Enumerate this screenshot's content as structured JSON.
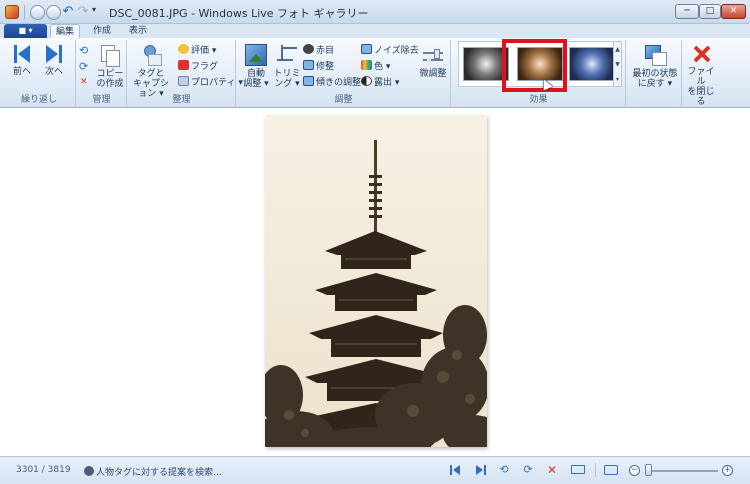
{
  "window": {
    "title": "DSC_0081.JPG - Windows Live フォト ギャラリー",
    "controls": {
      "minimize": "─",
      "maximize": "□",
      "close": "✕"
    }
  },
  "quick_access": {
    "back_icon": "back-icon",
    "forward_icon": "forward-icon",
    "undo": "↶",
    "redo": "↷",
    "dropdown": "▾"
  },
  "tabs": {
    "file_menu": "■ ▾",
    "items": [
      "編集",
      "作成",
      "表示"
    ],
    "active": "編集"
  },
  "ribbon": {
    "navigate": {
      "label": "繰り返し",
      "prev": "前へ",
      "next": "次へ"
    },
    "manage": {
      "label": "管理",
      "rotate_left": "⟲",
      "rotate_right": "⟳",
      "delete": "✕",
      "copy": "コピーの作成"
    },
    "organize": {
      "label": "整理",
      "tag_caption": "タグと キャプション ▾",
      "rating": "評価 ▾",
      "flag": "フラグ",
      "properties": "プロパティ ▾"
    },
    "adjust": {
      "label": "調整",
      "auto": "自動 調整 ▾",
      "crop": "トリミ ング ▾",
      "redeye": "赤目",
      "retouch": "修整",
      "straighten": "傾きの調整",
      "noise": "ノイズ除去",
      "color": "色 ▾",
      "exposure": "露出 ▾",
      "fine_tune": "微調整"
    },
    "effects": {
      "label": "効果",
      "items": [
        "白黒",
        "セピア",
        "シアン"
      ],
      "selected": "セピア"
    },
    "revert": {
      "label": "最初の状態 に戻す ▾"
    },
    "close_file": {
      "label": "ファイル を閉じる"
    }
  },
  "photo": {
    "filename": "DSC_0081.JPG",
    "effect": "sepia",
    "subject": "pagoda"
  },
  "statusbar": {
    "position": "3301 / 3819",
    "suggestion": "人物タグに対する提案を検索..."
  },
  "colors": {
    "accent": "#2a6fc9",
    "highlight": "#e0131c",
    "delete": "#d8352a"
  }
}
